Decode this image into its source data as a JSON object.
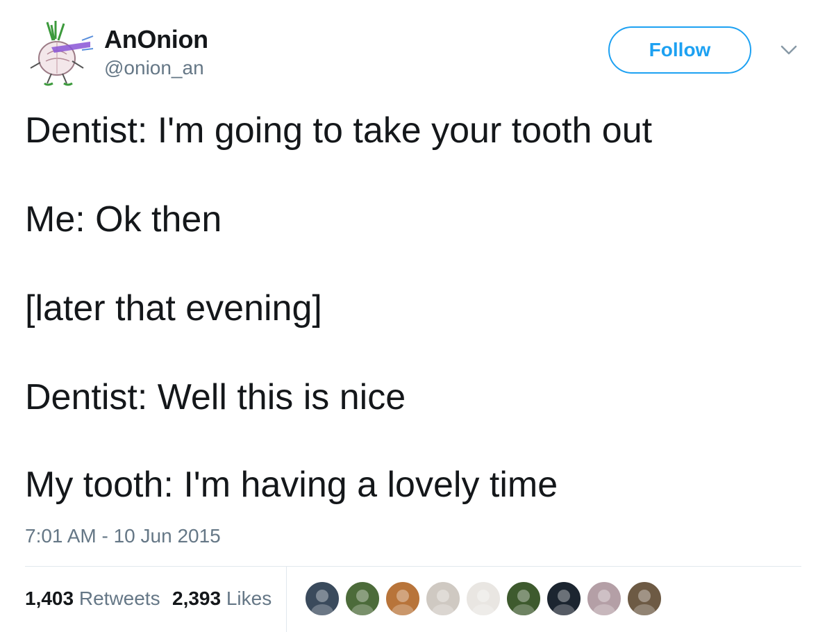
{
  "user": {
    "display_name": "AnOnion",
    "handle": "@onion_an",
    "avatar_icon": "onion-avatar-icon"
  },
  "follow_label": "Follow",
  "menu_icon": "chevron-down-icon",
  "tweet": {
    "lines": [
      "Dentist: I'm going to take your tooth out",
      "Me: Ok then",
      "[later that evening]",
      "Dentist: Well this is nice",
      "My tooth: I'm having a lovely time"
    ],
    "timestamp": "7:01 AM - 10 Jun 2015"
  },
  "stats": {
    "retweets_count": "1,403",
    "retweets_label": "Retweets",
    "likes_count": "2,393",
    "likes_label": "Likes"
  },
  "colors": {
    "accent": "#1da1f2",
    "text": "#14171a",
    "muted": "#657786",
    "border": "#e1e8ed"
  },
  "likers": [
    {
      "name": "liker-avatar-1",
      "bg": "#3a4a5c"
    },
    {
      "name": "liker-avatar-2",
      "bg": "#4c6b3a"
    },
    {
      "name": "liker-avatar-3",
      "bg": "#b8743a"
    },
    {
      "name": "liker-avatar-4",
      "bg": "#cfc9c2"
    },
    {
      "name": "liker-avatar-5",
      "bg": "#e9e6e2"
    },
    {
      "name": "liker-avatar-6",
      "bg": "#3e5a2e"
    },
    {
      "name": "liker-avatar-7",
      "bg": "#1c2530"
    },
    {
      "name": "liker-avatar-8",
      "bg": "#b49fa6"
    },
    {
      "name": "liker-avatar-9",
      "bg": "#6d5a44"
    }
  ]
}
